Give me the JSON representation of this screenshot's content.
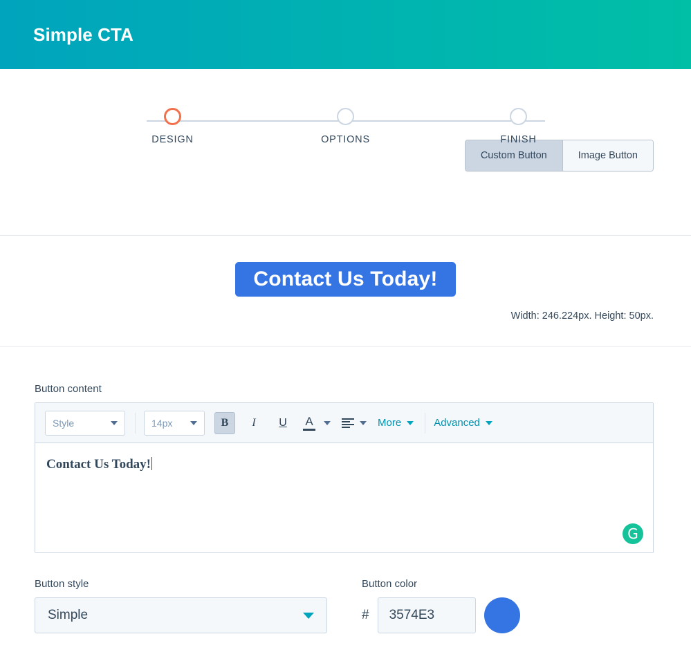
{
  "header": {
    "title": "Simple CTA",
    "gradient_from": "#00A4BD",
    "gradient_to": "#00BFA6"
  },
  "stepper": {
    "steps": [
      {
        "label": "DESIGN",
        "active": true
      },
      {
        "label": "OPTIONS",
        "active": false
      },
      {
        "label": "FINISH",
        "active": false
      }
    ],
    "active_color": "#F2714C",
    "inactive_color": "#CBD6E2"
  },
  "type_toggle": {
    "options": [
      {
        "label": "Custom Button",
        "selected": true
      },
      {
        "label": "Image Button",
        "selected": false
      }
    ]
  },
  "preview": {
    "cta_text": "Contact Us Today!",
    "cta_color": "#3574E3",
    "dimensions_text": "Width: 246.224px. Height: 50px."
  },
  "button_content": {
    "label": "Button content",
    "toolbar": {
      "style_select": "Style",
      "size_select": "14px",
      "bold": "B",
      "italic": "I",
      "underline": "U",
      "text_color": "A",
      "more": "More",
      "advanced": "Advanced"
    },
    "editor_value": "Contact Us Today!",
    "grammarly_glyph": "G"
  },
  "button_style": {
    "label": "Button style",
    "value": "Simple",
    "options": [
      "Simple"
    ]
  },
  "button_color": {
    "label": "Button color",
    "hash": "#",
    "value": "3574E3",
    "swatch_color": "#3574E3"
  }
}
